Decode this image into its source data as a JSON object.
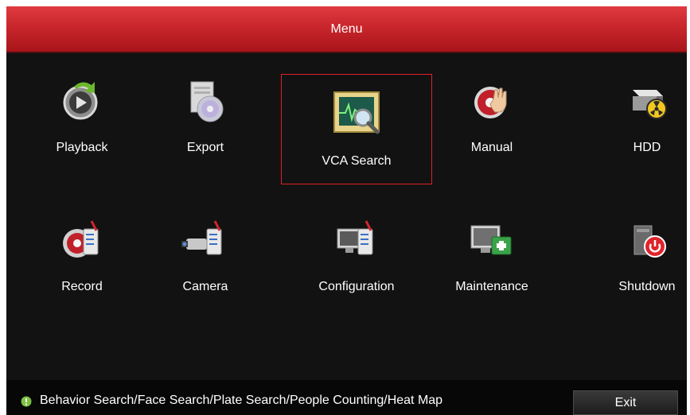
{
  "window": {
    "title": "Menu"
  },
  "menu": {
    "items": [
      {
        "label": "Playback",
        "icon": "playback-icon",
        "selected": false
      },
      {
        "label": "Export",
        "icon": "export-disc-icon",
        "selected": false
      },
      {
        "label": "VCA Search",
        "icon": "vca-search-icon",
        "selected": true
      },
      {
        "label": "Manual",
        "icon": "manual-record-icon",
        "selected": false
      },
      {
        "label": "HDD",
        "icon": "hdd-icon",
        "selected": false
      },
      {
        "label": "Record",
        "icon": "record-settings-icon",
        "selected": false
      },
      {
        "label": "Camera",
        "icon": "camera-settings-icon",
        "selected": false
      },
      {
        "label": "Configuration",
        "icon": "configuration-icon",
        "selected": false
      },
      {
        "label": "Maintenance",
        "icon": "maintenance-icon",
        "selected": false
      },
      {
        "label": "Shutdown",
        "icon": "shutdown-icon",
        "selected": false
      }
    ]
  },
  "status": {
    "hint": "Behavior Search/Face Search/Plate Search/People Counting/Heat Map",
    "hint_icon": "info-icon"
  },
  "buttons": {
    "exit": "Exit"
  },
  "colors": {
    "titlebar": "#c8262c",
    "selection_border": "#e02027",
    "background": "#121212"
  }
}
